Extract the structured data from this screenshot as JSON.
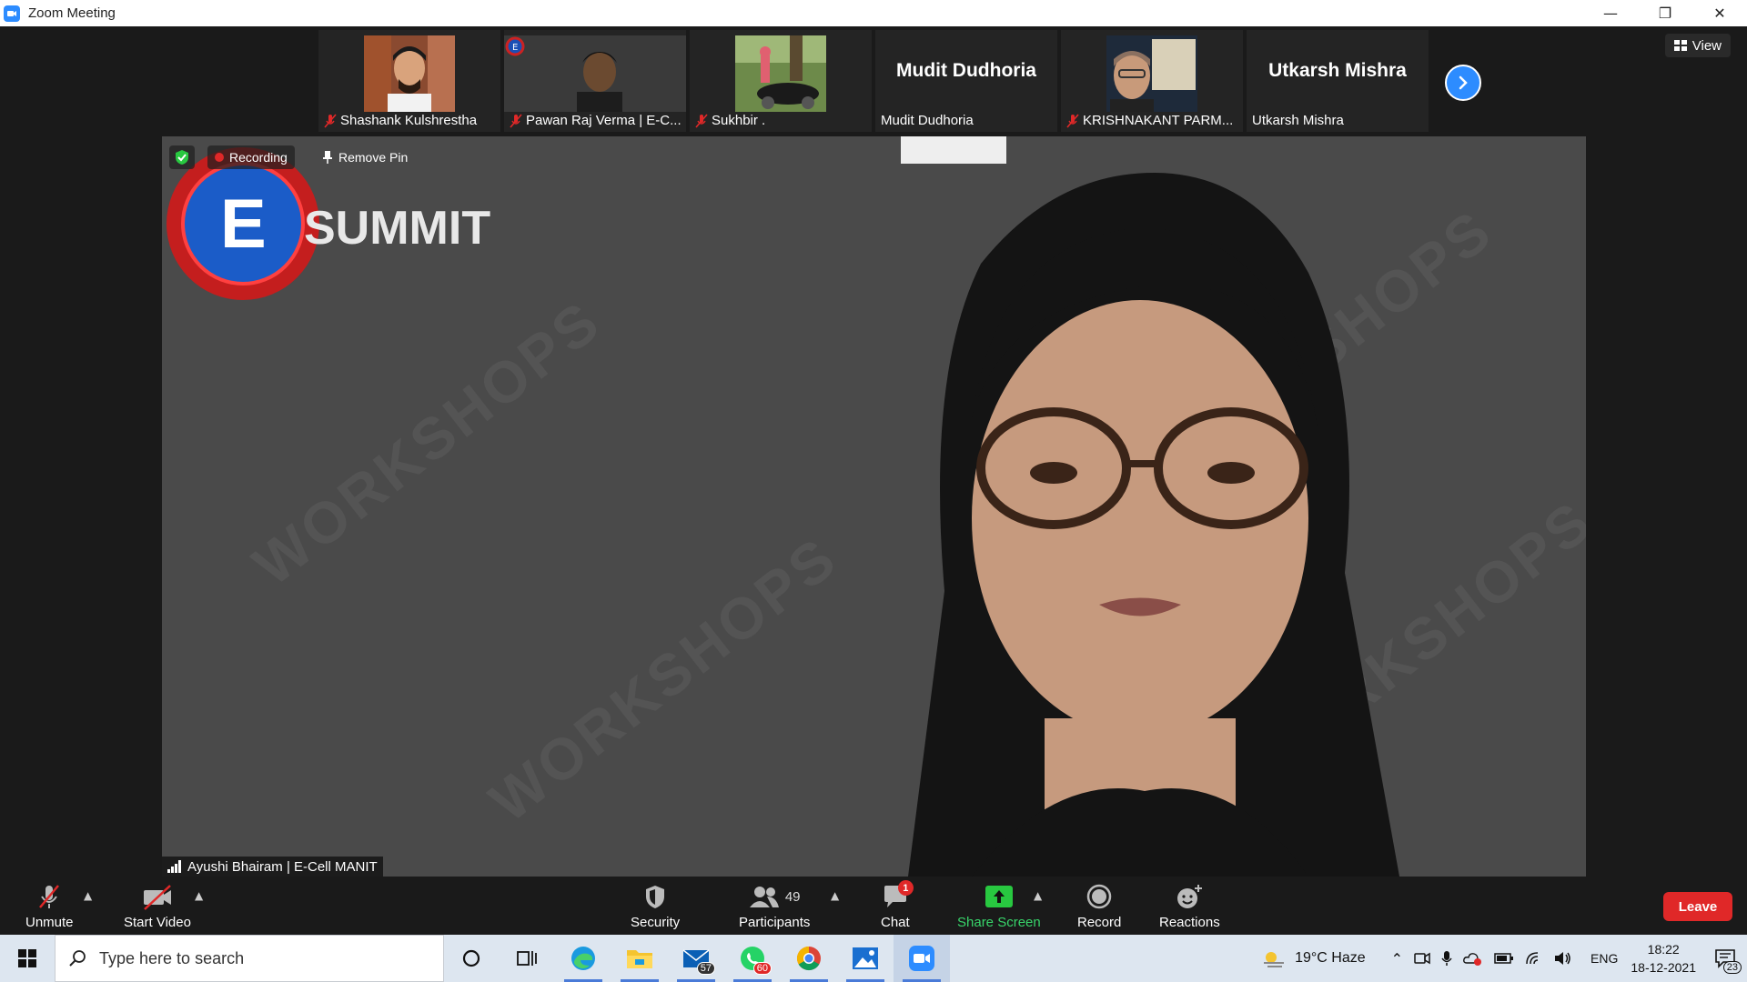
{
  "window": {
    "title": "Zoom Meeting",
    "controls": [
      "minimize",
      "restore",
      "close"
    ]
  },
  "thumbnails": [
    {
      "name": "Shashank Kulshrestha",
      "muted": true,
      "has_video": true
    },
    {
      "name": "Pawan Raj Verma | E-C...",
      "muted": true,
      "has_video": true
    },
    {
      "name": "Sukhbir .",
      "muted": true,
      "has_video": true
    },
    {
      "name": "Mudit Dudhoria",
      "display_name": "Mudit Dudhoria",
      "muted": false,
      "has_video": false
    },
    {
      "name": "KRISHNAKANT PARM...",
      "muted": true,
      "has_video": true
    },
    {
      "name": "Utkarsh Mishra",
      "display_name": "Utkarsh Mishra",
      "muted": false,
      "has_video": false
    }
  ],
  "view_button": {
    "label": "View"
  },
  "main_video": {
    "recording_label": "Recording",
    "remove_pin_label": "Remove Pin",
    "speaker_name": "Ayushi Bhairam | E-Cell MANIT",
    "logo_text": "SUMMIT",
    "logo_letter": "E",
    "watermark_text": "WORKSHOPS"
  },
  "toolbar": {
    "unmute": "Unmute",
    "start_video": "Start Video",
    "security": "Security",
    "participants": "Participants",
    "participants_count": "49",
    "chat": "Chat",
    "chat_badge": "1",
    "share_screen": "Share Screen",
    "record": "Record",
    "reactions": "Reactions",
    "leave": "Leave"
  },
  "taskbar": {
    "search_placeholder": "Type here to search",
    "mail_count": "57",
    "whatsapp_count": "60",
    "weather": "19°C  Haze",
    "language": "ENG",
    "time": "18:22",
    "date": "18-12-2021",
    "notifications_count": "23"
  },
  "colors": {
    "zoom_blue": "#2d8cff",
    "leave_red": "#e02828",
    "share_green": "#38d46a"
  }
}
